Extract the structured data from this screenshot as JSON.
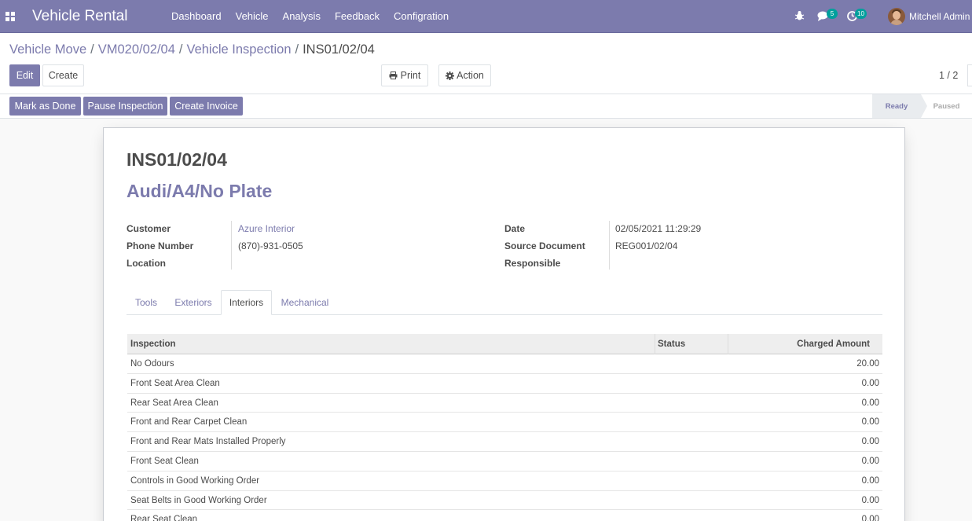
{
  "navbar": {
    "brand": "Vehicle Rental",
    "menu": [
      "Dashboard",
      "Vehicle",
      "Analysis",
      "Feedback",
      "Configration"
    ],
    "messages_count": "5",
    "activities_count": "10",
    "user_name": "Mitchell Admin (",
    "accent_color": "#7c7bad"
  },
  "breadcrumb": {
    "items": [
      "Vehicle Move",
      "VM020/02/04",
      "Vehicle Inspection"
    ],
    "current": "INS01/02/04",
    "separator": "/"
  },
  "toolbar": {
    "edit_label": "Edit",
    "create_label": "Create",
    "print_label": "Print",
    "action_label": "Action",
    "pager": "1 / 2"
  },
  "statusbar": {
    "buttons": [
      "Mark as Done",
      "Pause Inspection",
      "Create Invoice"
    ],
    "stages": [
      "Ready",
      "Paused"
    ],
    "active_stage": "Ready"
  },
  "record": {
    "name": "INS01/02/04",
    "vehicle": "Audi/A4/No Plate",
    "left_fields": [
      {
        "label": "Customer",
        "value": "Azure Interior",
        "link": true
      },
      {
        "label": "Phone Number",
        "value": "(870)-931-0505",
        "link": false
      },
      {
        "label": "Location",
        "value": "",
        "link": false
      }
    ],
    "right_fields": [
      {
        "label": "Date",
        "value": "02/05/2021 11:29:29"
      },
      {
        "label": "Source Document",
        "value": "REG001/02/04"
      },
      {
        "label": "Responsible",
        "value": ""
      }
    ]
  },
  "tabs": [
    "Tools",
    "Exteriors",
    "Interiors",
    "Mechanical"
  ],
  "active_tab": "Interiors",
  "table": {
    "columns": [
      "Inspection",
      "Status",
      "Charged Amount"
    ],
    "rows": [
      {
        "inspection": "No Odours",
        "status": "",
        "amount": "20.00"
      },
      {
        "inspection": "Front Seat Area Clean",
        "status": "",
        "amount": "0.00"
      },
      {
        "inspection": "Rear Seat Area Clean",
        "status": "",
        "amount": "0.00"
      },
      {
        "inspection": "Front and Rear Carpet Clean",
        "status": "",
        "amount": "0.00"
      },
      {
        "inspection": "Front and Rear Mats Installed Properly",
        "status": "",
        "amount": "0.00"
      },
      {
        "inspection": "Front Seat Clean",
        "status": "",
        "amount": "0.00"
      },
      {
        "inspection": "Controls in Good Working Order",
        "status": "",
        "amount": "0.00"
      },
      {
        "inspection": "Seat Belts in Good Working Order",
        "status": "",
        "amount": "0.00"
      },
      {
        "inspection": "Rear Seat Clean",
        "status": "",
        "amount": "0.00"
      }
    ]
  }
}
